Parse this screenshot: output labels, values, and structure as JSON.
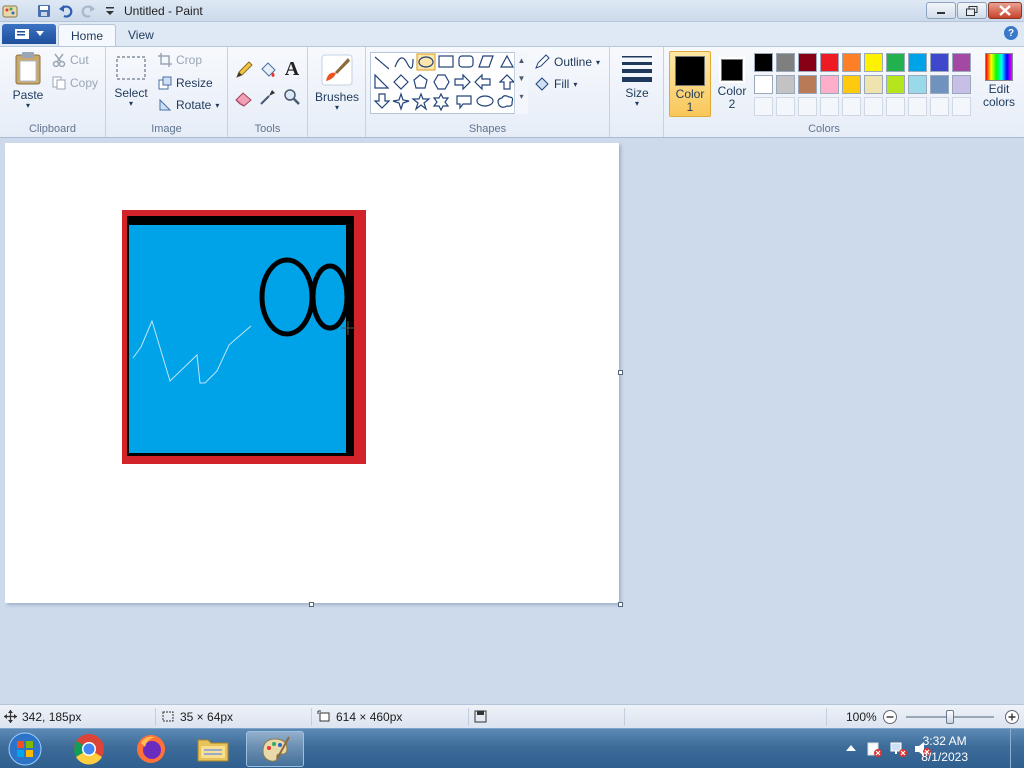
{
  "window": {
    "title": "Untitled - Paint"
  },
  "tabs": {
    "home": "Home",
    "view": "View"
  },
  "help_icon": "?",
  "clipboard": {
    "paste": "Paste",
    "cut": "Cut",
    "copy": "Copy",
    "group": "Clipboard"
  },
  "image": {
    "select": "Select",
    "crop": "Crop",
    "resize": "Resize",
    "rotate": "Rotate",
    "group": "Image"
  },
  "tools": {
    "group": "Tools",
    "text_tool": "A"
  },
  "brushes": {
    "label": "Brushes"
  },
  "shapes": {
    "group": "Shapes",
    "outline": "Outline",
    "fill": "Fill"
  },
  "size": {
    "label": "Size"
  },
  "colors": {
    "color1_line1": "Color",
    "color1_line2": "1",
    "color2_line1": "Color",
    "color2_line2": "2",
    "edit_line1": "Edit",
    "edit_line2": "colors",
    "group": "Colors",
    "color1_value": "#000000",
    "color2_value": "#000000",
    "palette_row1": [
      "#000000",
      "#7f7f7f",
      "#880015",
      "#ed1c24",
      "#ff7f27",
      "#fff200",
      "#22b14c",
      "#00a2e8",
      "#3f48cc",
      "#a349a4"
    ],
    "palette_row2": [
      "#ffffff",
      "#c3c3c3",
      "#b97a57",
      "#ffaec9",
      "#ffc90e",
      "#efe4b0",
      "#b5e61d",
      "#99d9ea",
      "#7092be",
      "#c8bfe7"
    ]
  },
  "drawing": {
    "frame_red": "#d2232a",
    "frame_black": "#000000",
    "fill_blue": "#00a2e8",
    "scribble": "#bfe6f7"
  },
  "status": {
    "cursor_pos": "342, 185px",
    "selection_size": "35 × 64px",
    "canvas_size": "614 × 460px",
    "zoom": "100%"
  },
  "taskbar": {
    "time": "3:32 AM",
    "date": "8/1/2023"
  }
}
